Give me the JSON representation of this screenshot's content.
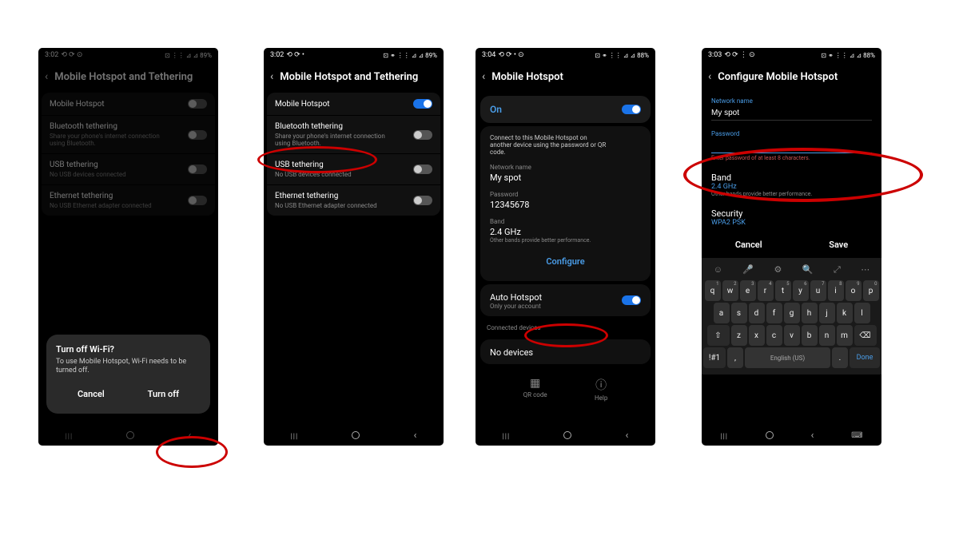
{
  "screen1": {
    "time": "3:02",
    "status_icons": "⟲ ⟳ ⊙",
    "battery": "89%",
    "signal": "⊡ ⋮⋮ ⊿ ⊿",
    "title": "Mobile Hotspot and Tethering",
    "items": [
      {
        "title": "Mobile Hotspot",
        "sub": "",
        "on": false
      },
      {
        "title": "Bluetooth tethering",
        "sub": "Share your phone's internet connection using Bluetooth.",
        "on": false
      },
      {
        "title": "USB tethering",
        "sub": "No USB devices connected",
        "on": false
      },
      {
        "title": "Ethernet tethering",
        "sub": "No USB Ethernet adapter connected",
        "on": false
      }
    ],
    "dialog": {
      "title": "Turn off Wi-Fi?",
      "text": "To use Mobile Hotspot, Wi-Fi needs to be turned off.",
      "cancel": "Cancel",
      "confirm": "Turn off"
    }
  },
  "screen2": {
    "time": "3:02",
    "status_icons": "⟲ ⟳ •",
    "battery": "89%",
    "signal": "⊡ ⚭ ⋮⋮ ⊿ ⊿",
    "title": "Mobile Hotspot and Tethering",
    "items": [
      {
        "title": "Mobile Hotspot",
        "sub": "",
        "on": true
      },
      {
        "title": "Bluetooth tethering",
        "sub": "Share your phone's internet connection using Bluetooth.",
        "on": false
      },
      {
        "title": "USB tethering",
        "sub": "No USB devices connected",
        "on": false
      },
      {
        "title": "Ethernet tethering",
        "sub": "No USB Ethernet adapter connected",
        "on": false
      }
    ]
  },
  "screen3": {
    "time": "3:04",
    "status_icons": "⟲ ⟳ • ⊙",
    "battery": "88%",
    "signal": "⊡ ⚭ ⋮⋮ ⊿ ⊿",
    "title": "Mobile Hotspot",
    "on_label": "On",
    "connect_text": "Connect to this Mobile Hotspot on another device using the password or QR code.",
    "network_label": "Network name",
    "network_value": "My spot",
    "password_label": "Password",
    "password_value": "12345678",
    "band_label": "Band",
    "band_value": "2.4 GHz",
    "band_sub": "Other bands provide better performance.",
    "configure": "Configure",
    "auto_title": "Auto Hotspot",
    "auto_sub": "Only your account",
    "connected_label": "Connected devices",
    "no_devices": "No devices",
    "qr_label": "QR code",
    "help_label": "Help"
  },
  "screen4": {
    "time": "3:03",
    "status_icons": "⟲ ⟳ ⋮ ⊙",
    "battery": "88%",
    "signal": "⊡ ⚭ ⋮⋮ ⊿ ⊿",
    "title": "Configure Mobile Hotspot",
    "network_label": "Network name",
    "network_value": "My spot",
    "password_label": "Password",
    "password_hint": "Enter password of at least 8 characters.",
    "band_label": "Band",
    "band_value": "2.4 GHz",
    "band_sub": "Other bands provide better performance.",
    "security_label": "Security",
    "security_value": "WPA2 PSK",
    "cancel": "Cancel",
    "save": "Save",
    "keyboard": {
      "row1": [
        "q",
        "w",
        "e",
        "r",
        "t",
        "y",
        "u",
        "i",
        "o",
        "p"
      ],
      "nums1": [
        "1",
        "2",
        "3",
        "4",
        "5",
        "6",
        "7",
        "8",
        "9",
        "0"
      ],
      "row2": [
        "a",
        "s",
        "d",
        "f",
        "g",
        "h",
        "j",
        "k",
        "l"
      ],
      "row3": [
        "z",
        "x",
        "c",
        "v",
        "b",
        "n",
        "m"
      ],
      "shift": "⇧",
      "backspace": "⌫",
      "sym": "!#1",
      "comma": ",",
      "lang": "English (US)",
      "period": ".",
      "done": "Done"
    }
  }
}
